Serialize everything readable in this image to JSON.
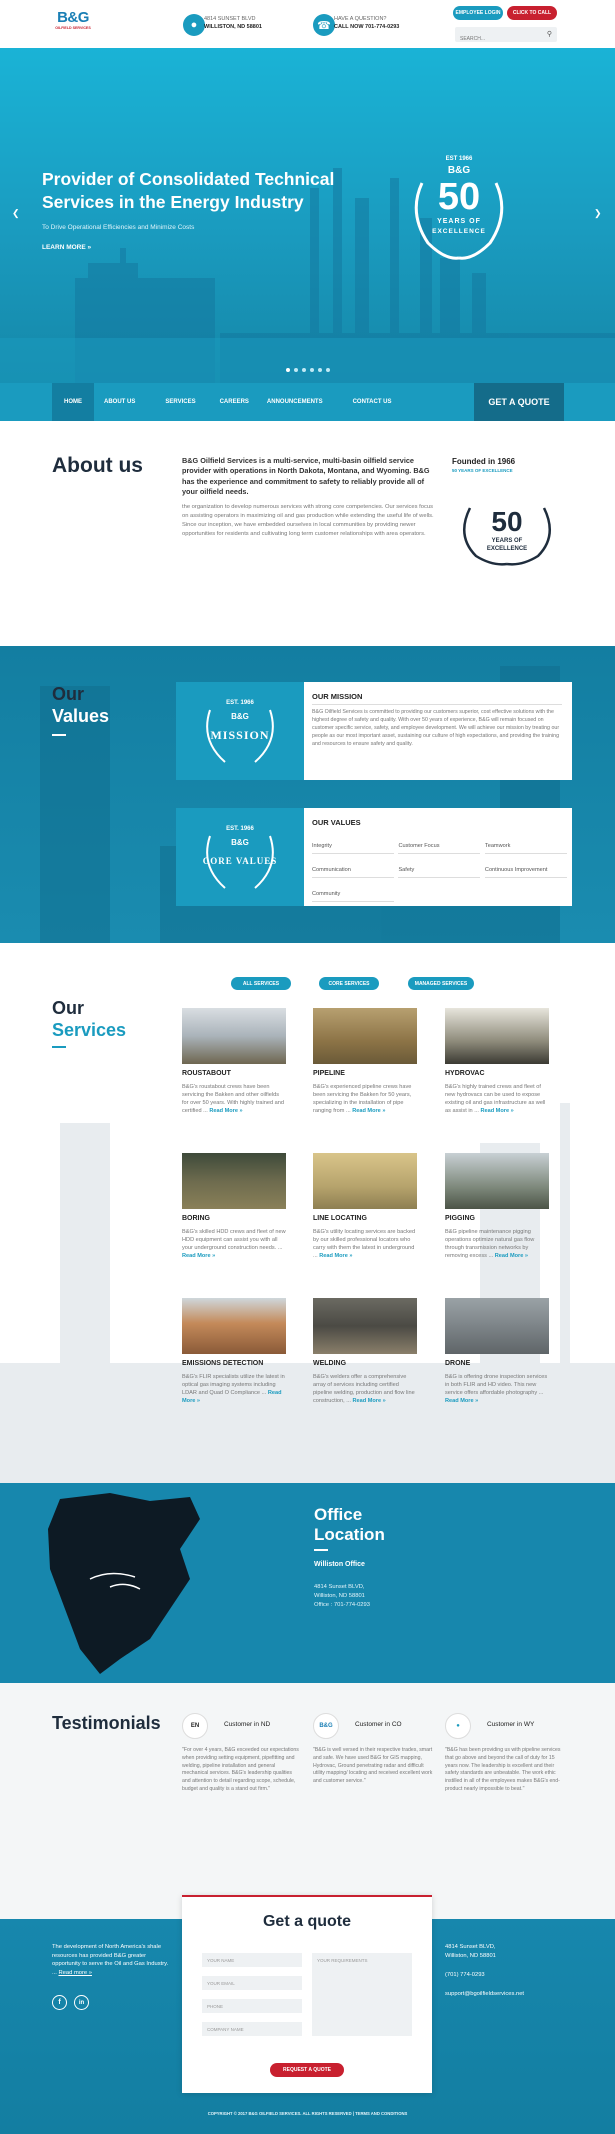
{
  "header": {
    "logo_text": "B&G",
    "logo_sub": "OILFIELD SERVICES",
    "address_line1": "4814 SUNSET BLVD",
    "address_line2": "WILLISTON, ND 58801",
    "question_line1": "HAVE A QUESTION?",
    "question_line2": "CALL NOW 701-774-0293",
    "employee_login": "EMPLOYEE LOGIN",
    "click_to_call": "CLICK TO CALL",
    "search_placeholder": "SEARCH..."
  },
  "hero": {
    "title": "Provider of Consolidated Technical Services in the Energy Industry",
    "subtitle": "To Drive Operational Efficiencies and Minimize Costs",
    "cta": "LEARN MORE »",
    "badge_est": "EST 1966",
    "badge_logo": "B&G",
    "badge_num": "50",
    "badge_years": "YEARS OF",
    "badge_excellence": "EXCELLENCE"
  },
  "nav": {
    "items": [
      "HOME",
      "ABOUT US",
      "SERVICES",
      "CAREERS",
      "ANNOUNCEMENTS",
      "CONTACT US"
    ],
    "quote": "GET A QUOTE"
  },
  "about": {
    "heading": "About us",
    "lead": "B&G Oilfield Services is a multi-service, multi-basin oilfield service provider with operations in North Dakota, Montana, and Wyoming. B&G has the experience and commitment to safety to reliably provide all of your oilfield needs.",
    "body": "the organization to develop numerous services with strong core competencies. Our services focus on assisting operators in maximizing oil and gas production while extending the useful life of wells. Since our inception, we have embedded ourselves in local communities by providing newer opportunities for residents and cultivating long term customer relationships with area operators.",
    "founded": "Founded in 1966",
    "founded_sub": "50 YEARS OF EXCELLENCE"
  },
  "values": {
    "heading_line1": "Our",
    "heading_line2": "Values",
    "mission_label": "MISSION",
    "mission_title": "OUR MISSION",
    "mission_text": "B&G Oilfield Services is committed to providing our customers superior, cost effective solutions with the highest degree of safety and quality. With over 50 years of experience, B&G will remain focused on customer specific service, safety, and employee development. We will achieve our mission by treating our people as our most important asset, sustaining our culture of high expectations, and providing the training and resources to ensure safety and quality.",
    "core_label": "CORE VALUES",
    "values_title": "OUR VALUES",
    "items": [
      "Integrity",
      "Customer Focus",
      "Teamwork",
      "Communication",
      "Safety",
      "Continuous Improvement",
      "Community"
    ],
    "badge_est": "EST. 1966"
  },
  "services": {
    "heading_line1": "Our",
    "heading_line2": "Services",
    "filters": [
      "ALL SERVICES",
      "CORE SERVICES",
      "MANAGED SERVICES"
    ],
    "items": [
      {
        "title": "ROUSTABOUT",
        "desc": "B&G's roustabout crews have been servicing the Bakken and other oilfields for over 50 years. With highly trained and certified ...",
        "more": "Read More »"
      },
      {
        "title": "PIPELINE",
        "desc": "B&G's experienced pipeline crews have been servicing the Bakken for 50 years, specializing in the installation of pipe ranging from ...",
        "more": "Read More »"
      },
      {
        "title": "HYDROVAC",
        "desc": "B&G's highly trained crews and fleet of new hydrovacs can be used to expose existing oil and gas infrastructure as well as assist in ...",
        "more": "Read More »"
      },
      {
        "title": "BORING",
        "desc": "B&G's skilled HDD crews and fleet of new HDD equipment can assist you with all your underground construction needs. ...",
        "more": "Read More »"
      },
      {
        "title": "LINE LOCATING",
        "desc": "B&G's utility locating services are backed by our skilled professional locators who carry with them the latest in underground ...",
        "more": "Read More »"
      },
      {
        "title": "PIGGING",
        "desc": "B&G pipeline maintenance pigging operations optimize natural gas flow through transmission networks by removing excess ...",
        "more": "Read More »"
      },
      {
        "title": "EMISSIONS DETECTION",
        "desc": "B&G's FLIR specialists utilize the latest in optical gas imaging systems including LDAR and Quad O Compliance ...",
        "more": "Read More »"
      },
      {
        "title": "WELDING",
        "desc": "B&G's welders offer a comprehensive array of services including certified pipeline welding, production and flow line construction, ...",
        "more": "Read More »"
      },
      {
        "title": "DRONE",
        "desc": "B&G is offering drone inspection services in both FLIR and HD video. This new service offers affordable photography ...",
        "more": "Read More »"
      }
    ]
  },
  "office": {
    "heading_line1": "Office",
    "heading_line2": "Location",
    "name": "Williston Office",
    "line1": "4814 Sunset BLVD,",
    "line2": "Williston, ND 58801",
    "phone": "Office : 701-774-0293"
  },
  "testimonials": {
    "heading": "Testimonials",
    "items": [
      {
        "customer": "Customer in ND",
        "text": "\"For over 4 years, B&G exceeded our expectations when providing setting equipment, pipefitting and welding, pipeline installation and general mechanical services. B&G's leadership qualities and attention to detail regarding scope, schedule, budget and quality is a stand out firm.\""
      },
      {
        "customer": "Customer in CO",
        "text": "\"B&G is well versed in their respective trades, smart and safe. We have used B&G for GIS mapping, Hydrovac, Ground penetrating radar and difficult utility mapping/ locating and received excellent work and customer service.\""
      },
      {
        "customer": "Customer in WY",
        "text": "\"B&G has been providing us with pipeline services that go above and beyond the call of duty for 15 years now. The leadership is excellent and their safety standards are unbeatable. The work ethic instilled in all of the employees makes B&G's end-product nearly impossible to beat.\""
      }
    ]
  },
  "footer": {
    "blurb": "The development of North America's shale resources has provided B&G greater opportunity to serve the Oil and Gas Industry. ...",
    "read_more": "Read more »",
    "address1": "4814 Sunset BLVD,",
    "address2": "Williston, ND 58801",
    "phone": "(701) 774-0293",
    "email": "support@bgoilfieldservices.net",
    "quote_title": "Get a quote",
    "fields": [
      "YOUR NAME",
      "YOUR EMAIL",
      "PHONE",
      "COMPANY NAME"
    ],
    "message": "YOUR REQUIREMENTS",
    "submit": "REQUEST A QUOTE",
    "copyright": "COPYRIGHT © 2017 B&G OILFIELD SERVICES. ALL RIGHTS RESERVED | TERMS AND CONDITIONS"
  },
  "colors": {
    "teal": "#1a9bbf",
    "dark_teal": "#146c8a",
    "red": "#c8202f",
    "navy": "#1f2d3d"
  }
}
